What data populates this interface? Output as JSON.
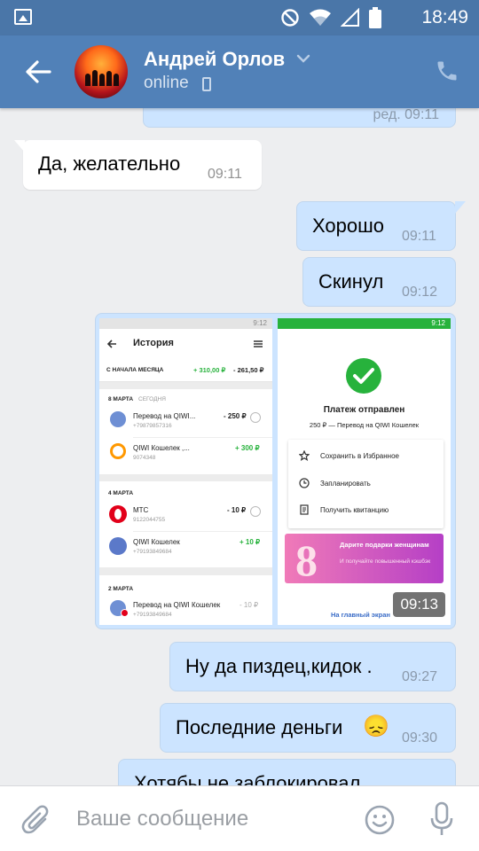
{
  "status_bar": {
    "time": "18:49"
  },
  "header": {
    "name": "Андрей Орлов",
    "status": "online"
  },
  "messages": {
    "prev_edited": "ред. 09:11",
    "m1": {
      "text": "Да, желательно",
      "time": "09:11"
    },
    "m2": {
      "text": "Хорошо",
      "time": "09:11"
    },
    "m3": {
      "text": "Скинул",
      "time": "09:12"
    },
    "m4": {
      "time": "09:13"
    },
    "m5": {
      "text": "Ну да пиздец,кидок .",
      "time": "09:27"
    },
    "m6": {
      "text": "Последние деньги",
      "emoji": "😞",
      "time": "09:30"
    },
    "m7": {
      "text": "Хотябы не заблокировал"
    }
  },
  "attachment": {
    "left": {
      "status_time": "9:12",
      "title": "История",
      "period_label": "С НАЧАЛА МЕСЯЦА",
      "period_in": "+ 310,00 ₽",
      "period_out": "- 261,50 ₽",
      "groups": [
        {
          "date": "8 МАРТА",
          "tag": "СЕГОДНЯ",
          "items": [
            {
              "title": "Перевод на QIWI...",
              "sub": "+79879857316",
              "amount": "- 250 ₽",
              "color": "#6e8fd4"
            },
            {
              "title": "QIWI Кошелек ,...",
              "sub": "9074348",
              "amount": "+ 300 ₽",
              "color": "#ff9800"
            }
          ]
        },
        {
          "date": "4 МАРТА",
          "items": [
            {
              "title": "МТС",
              "sub": "9122044755",
              "amount": "- 10 ₽",
              "color": "#e2001a"
            },
            {
              "title": "QIWI Кошелек",
              "sub": "+79193849684",
              "amount": "+ 10 ₽",
              "color": "#5b79c9"
            }
          ]
        },
        {
          "date": "2 МАРТА",
          "items": [
            {
              "title": "Перевод на QIWI Кошелек",
              "sub": "+79193849684",
              "amount": "- 10 ₽",
              "color": "#6e8fd4"
            }
          ]
        }
      ]
    },
    "right": {
      "status_time": "9:12",
      "title": "Платеж отправлен",
      "sub": "250 ₽ — Перевод на QIWI Кошелек",
      "actions": [
        "Сохранить в Избранное",
        "Запланировать",
        "Получить квитанцию"
      ],
      "promo_num": "8",
      "promo_title": "Дарите подарки женщинам",
      "promo_sub": "И получайте повышенный кэшбэк",
      "link": "На главный экран"
    }
  },
  "input": {
    "placeholder": "Ваше сообщение"
  },
  "colors": {
    "header": "#5181b8",
    "statusbar": "#4a76a8",
    "out_bubble": "#cce4ff",
    "in_bubble": "#ffffff",
    "background": "#edeef0",
    "qiwi_green": "#27b23c"
  }
}
